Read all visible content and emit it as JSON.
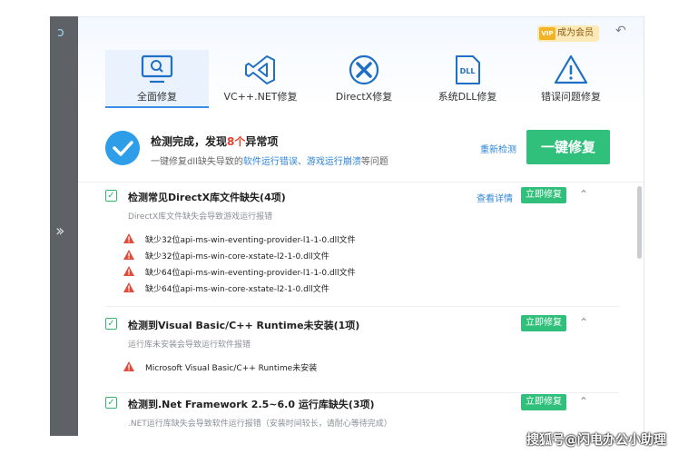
{
  "header": {
    "vip_badge": "VIP",
    "vip_label": "成为会员",
    "back_icon": "back-arrow-icon"
  },
  "tabs": [
    {
      "label": "全面修复",
      "icon": "monitor-search-icon",
      "active": true
    },
    {
      "label": "VC++.NET修复",
      "icon": "visual-studio-icon",
      "active": false
    },
    {
      "label": "DirectX修复",
      "icon": "directx-icon",
      "active": false
    },
    {
      "label": "系统DLL修复",
      "icon": "dll-file-icon",
      "active": false
    },
    {
      "label": "错误问题修复",
      "icon": "warning-icon",
      "active": false
    }
  ],
  "summary": {
    "title_prefix": "检测完成，发现",
    "issue_count": "8个",
    "title_suffix": "异常项",
    "sub_prefix": "一键修复dll缺失导致的",
    "sub_link1": "软件运行错误",
    "sub_sep": "、",
    "sub_link2": "游戏运行崩溃",
    "sub_suffix": "等问题",
    "recheck_label": "重新检测",
    "fix_all_label": "一键修复"
  },
  "sections": [
    {
      "title": "检测常见DirectX库文件缺失(4项)",
      "description": "DirectX库文件缺失会导致游戏运行报错",
      "detail_label": "查看详情",
      "fix_label": "立即修复",
      "items": [
        "缺少32位api-ms-win-eventing-provider-l1-1-0.dll文件",
        "缺少32位api-ms-win-core-xstate-l2-1-0.dll文件",
        "缺少64位api-ms-win-eventing-provider-l1-1-0.dll文件",
        "缺少64位api-ms-win-core-xstate-l2-1-0.dll文件"
      ]
    },
    {
      "title": "检测到Visual Basic/C++ Runtime未安装(1项)",
      "description": "运行库未安装会导致运行软件报错",
      "fix_label": "立即修复",
      "items": [
        "Microsoft Visual Basic/C++ Runtime未安装"
      ]
    },
    {
      "title": "检测到.Net Framework 2.5~6.0 运行库缺失(3项)",
      "description": ".NET运行库缺失会导致软件运行报错（安装时间较长，请耐心等待完成）",
      "fix_label": "立即修复",
      "items": []
    }
  ],
  "watermark": "搜狐号@闪电办公小助理"
}
